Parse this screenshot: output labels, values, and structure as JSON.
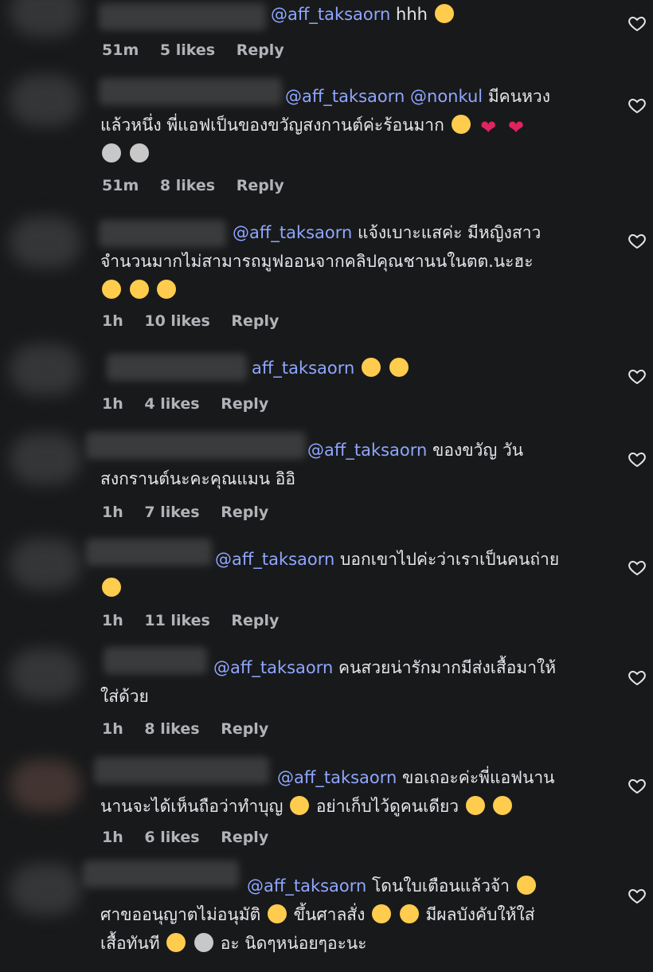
{
  "comments": [
    {
      "mention": "@aff_taksaorn",
      "text": "hhh",
      "emojis": [
        "rofl"
      ],
      "time": "51m",
      "likes": "5 likes",
      "reply": "Reply"
    },
    {
      "mention": "@aff_taksaorn @nonkul",
      "text": "มีคนหวง แล้วหนึ่ง พี่แอฟเป็นของขวัญสงกานต์ค่ะร้อนมาก",
      "emojis": [
        "raised-hands",
        "heart",
        "heart",
        "koala",
        "rabbit"
      ],
      "time": "51m",
      "likes": "8 likes",
      "reply": "Reply"
    },
    {
      "mention": "@aff_taksaorn",
      "text": "แจ้งเบาะแสค่ะ มีหญิงสาวจำนวนมากไม่สามารถมูฟออนจากคลิปคุณชานนในตต.นะฮะ",
      "emojis": [
        "tongue-out",
        "blush",
        "grin"
      ],
      "time": "1h",
      "likes": "10 likes",
      "reply": "Reply"
    },
    {
      "mention": "aff_taksaorn",
      "text": "",
      "emojis": [
        "laugh",
        "laugh"
      ],
      "time": "1h",
      "likes": "4 likes",
      "reply": "Reply"
    },
    {
      "mention": "@aff_taksaorn",
      "text": "ของขวัญ วันสงกรานต์นะคะคุณแมน อิอิ",
      "emojis": [],
      "time": "1h",
      "likes": "7 likes",
      "reply": "Reply"
    },
    {
      "mention": "@aff_taksaorn",
      "text": "บอกเขาไปค่ะว่าเราเป็นคนถ่าย",
      "emojis": [
        "yum"
      ],
      "time": "1h",
      "likes": "11 likes",
      "reply": "Reply"
    },
    {
      "mention": "@aff_taksaorn",
      "text": "คนสวยน่ารักมากมีส่งเสื้อมาให้ใส่ด้วย",
      "emojis": [],
      "time": "1h",
      "likes": "8 likes",
      "reply": "Reply"
    },
    {
      "mention": "@aff_taksaorn",
      "text": "ขอเถอะค่ะพี่แอฟนานนานจะได้เห็นถือว่าทำบุญ",
      "text2": "อย่าเก็บไว้ดูคนเดียว",
      "emojis": [
        "laugh",
        "heart-eyes",
        "laugh"
      ],
      "time": "1h",
      "likes": "6 likes",
      "reply": "Reply"
    },
    {
      "mention": "@aff_taksaorn",
      "text": "โดนใบเตือนแล้วจ้า",
      "text2": "ศาขออนุญาตไม่อนุมัติ",
      "text3": "ขึ้นศาลสั่ง",
      "text4": "มีผลบังคับให้ใส่เสื้อทันที",
      "text5": "อะ นิดๆหน่อยๆอะนะ",
      "emojis": [
        "surprised",
        "sad",
        "laugh",
        "laugh",
        "sad",
        "rabbit"
      ],
      "time": "",
      "likes": "",
      "reply": ""
    }
  ],
  "colors": {
    "background": "#18191a",
    "mention": "#8fa6ff",
    "text": "#e4e6eb",
    "meta": "#b0b3b8"
  },
  "icons": {
    "like": "heart-outline-icon"
  }
}
